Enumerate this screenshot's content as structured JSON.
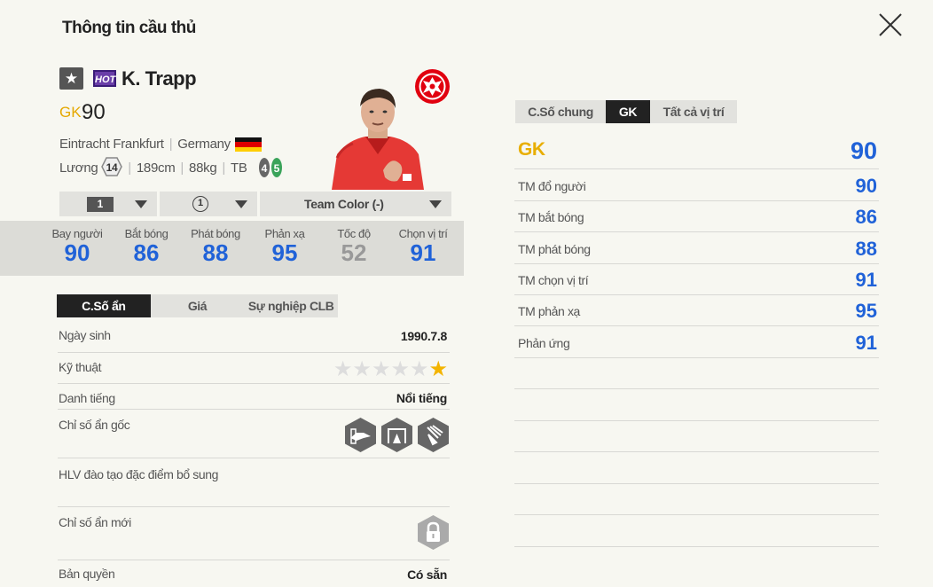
{
  "header": {
    "title": "Thông tin cầu thủ",
    "close_icon": "close-icon"
  },
  "player": {
    "name": "K. Trapp",
    "hot_label": "HOT",
    "position": "GK",
    "overall": "90",
    "club": "Eintracht Frankfurt",
    "nation": "Germany",
    "salary_label": "Lương",
    "salary": "14",
    "height": "189cm",
    "weight": "88kg",
    "body_type": "TB",
    "weak_foot": "4",
    "strong_foot": "5"
  },
  "dropdowns": {
    "level": "1",
    "training": "1",
    "team_color": "Team Color (-)"
  },
  "main_stats": [
    {
      "label": "Bay người",
      "value": "90"
    },
    {
      "label": "Bắt bóng",
      "value": "86"
    },
    {
      "label": "Phát bóng",
      "value": "88"
    },
    {
      "label": "Phản xạ",
      "value": "95"
    },
    {
      "label": "Tốc độ",
      "value": "52"
    },
    {
      "label": "Chọn vị trí",
      "value": "91"
    }
  ],
  "left_tabs": [
    "C.Số ẩn",
    "Giá",
    "Sự nghiệp CLB"
  ],
  "details": {
    "birth_label": "Ngày sinh",
    "birth": "1990.7.8",
    "skill_label": "Kỹ thuật",
    "skill_stars": 1,
    "fame_label": "Danh tiếng",
    "fame": "Nổi tiếng",
    "hidden_label": "Chỉ số ẩn gốc",
    "coach_label": "HLV đào tạo đặc điểm bổ sung",
    "new_hidden_label": "Chỉ số ẩn mới",
    "license_label": "Bản quyền",
    "license": "Có sẵn"
  },
  "right_tabs": [
    "C.Số chung",
    "GK",
    "Tất cả vị trí"
  ],
  "position_stats": {
    "head": {
      "label": "GK",
      "value": "90"
    },
    "rows": [
      {
        "label": "TM đổ người",
        "value": "90"
      },
      {
        "label": "TM bắt bóng",
        "value": "86"
      },
      {
        "label": "TM phát bóng",
        "value": "88"
      },
      {
        "label": "TM chọn vị trí",
        "value": "91"
      },
      {
        "label": "TM phản xạ",
        "value": "95"
      },
      {
        "label": "Phản ứng",
        "value": "91"
      }
    ]
  },
  "colors": {
    "accent_blue": "#2062d8",
    "gk_yellow": "#e8ae00",
    "star": "#f3b400"
  }
}
